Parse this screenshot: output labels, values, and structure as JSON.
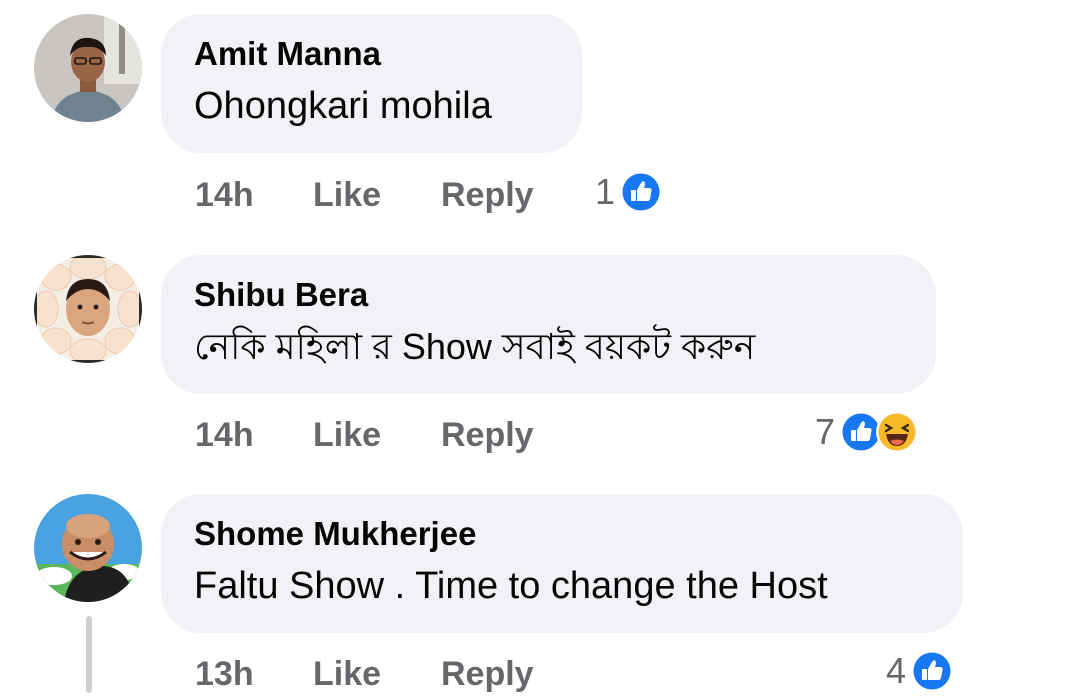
{
  "comments": [
    {
      "author": "Amit Manna",
      "text": "Ohongkari mohila",
      "time": "14h",
      "like_label": "Like",
      "reply_label": "Reply",
      "reaction_count": "1",
      "reactions": [
        "like-icon"
      ]
    },
    {
      "author": "Shibu Bera",
      "text": "নেকি মহিলা র Show সবাই বয়কট করুন",
      "time": "14h",
      "like_label": "Like",
      "reply_label": "Reply",
      "reaction_count": "7",
      "reactions": [
        "like-icon",
        "haha-icon"
      ]
    },
    {
      "author": "Shome Mukherjee",
      "text": "Faltu Show . Time to change the Host",
      "time": "13h",
      "like_label": "Like",
      "reply_label": "Reply",
      "reaction_count": "4",
      "reactions": [
        "like-icon"
      ]
    }
  ],
  "colors": {
    "bubble": "#f0f2f5",
    "like_blue": "#1877f2",
    "meta_gray": "#65676b",
    "haha_yellow": "#f7b928"
  }
}
